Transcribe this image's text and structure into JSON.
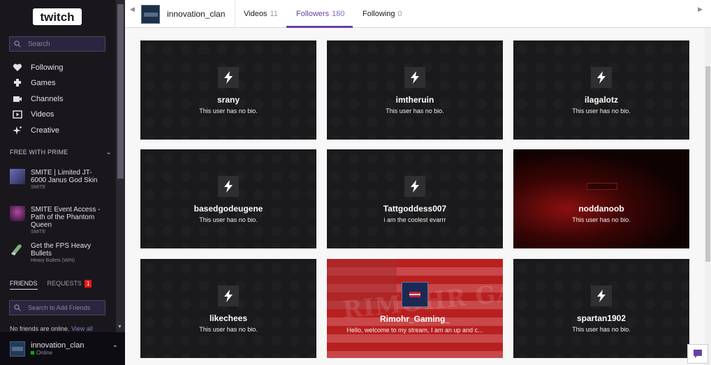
{
  "app": {
    "logo_text": "twitch"
  },
  "sidebar": {
    "search_placeholder": "Search",
    "nav": [
      {
        "label": "Following",
        "icon": "heart-icon"
      },
      {
        "label": "Games",
        "icon": "puzzle-icon"
      },
      {
        "label": "Channels",
        "icon": "camera-icon"
      },
      {
        "label": "Videos",
        "icon": "play-icon"
      },
      {
        "label": "Creative",
        "icon": "sparkle-icon"
      }
    ],
    "prime_heading": "FREE WITH PRIME",
    "prime_items": [
      {
        "title": "SMITE | Limited JT-6000 Janus God Skin",
        "sub": "SMITE"
      },
      {
        "title": "SMITE Event Access - Path of the Phantom Queen",
        "sub": "SMITE"
      },
      {
        "title": "Get the FPS Heavy Bullets",
        "sub": "Heavy Bullets (WIN)"
      }
    ],
    "friends_tab": "FRIENDS",
    "requests_tab": "REQUESTS",
    "requests_count": "1",
    "friend_search_placeholder": "Search to Add Friends",
    "no_friends_text": "No friends are online.",
    "view_all": "View all",
    "user": {
      "name": "innovation_clan",
      "status": "Online"
    }
  },
  "topbar": {
    "channel_name": "innovation_clan",
    "tabs": [
      {
        "label": "Videos",
        "count": "11"
      },
      {
        "label": "Followers",
        "count": "180",
        "active": true
      },
      {
        "label": "Following",
        "count": "0"
      }
    ]
  },
  "followers": [
    {
      "name": "srany",
      "bio": "This user has no bio."
    },
    {
      "name": "imtheruin",
      "bio": "This user has no bio."
    },
    {
      "name": "ilagalotz",
      "bio": "This user has no bio."
    },
    {
      "name": "basedgodeugene",
      "bio": "This user has no bio."
    },
    {
      "name": "Tattgoddess007",
      "bio": "i am the coolest evarrr"
    },
    {
      "name": "noddanoob",
      "bio": "This user has no bio."
    },
    {
      "name": "likechees",
      "bio": "This user has no bio."
    },
    {
      "name": "Rimohr_Gaming_",
      "bio": "Hello, welcome to my stream, I am an up and c...",
      "banner_text": "RIMOHR GAMING"
    },
    {
      "name": "spartan1902",
      "bio": "This user has no bio."
    }
  ],
  "colors": {
    "sidebar_bg": "#19171c",
    "accent": "#6441a4",
    "badge": "#e91916"
  }
}
